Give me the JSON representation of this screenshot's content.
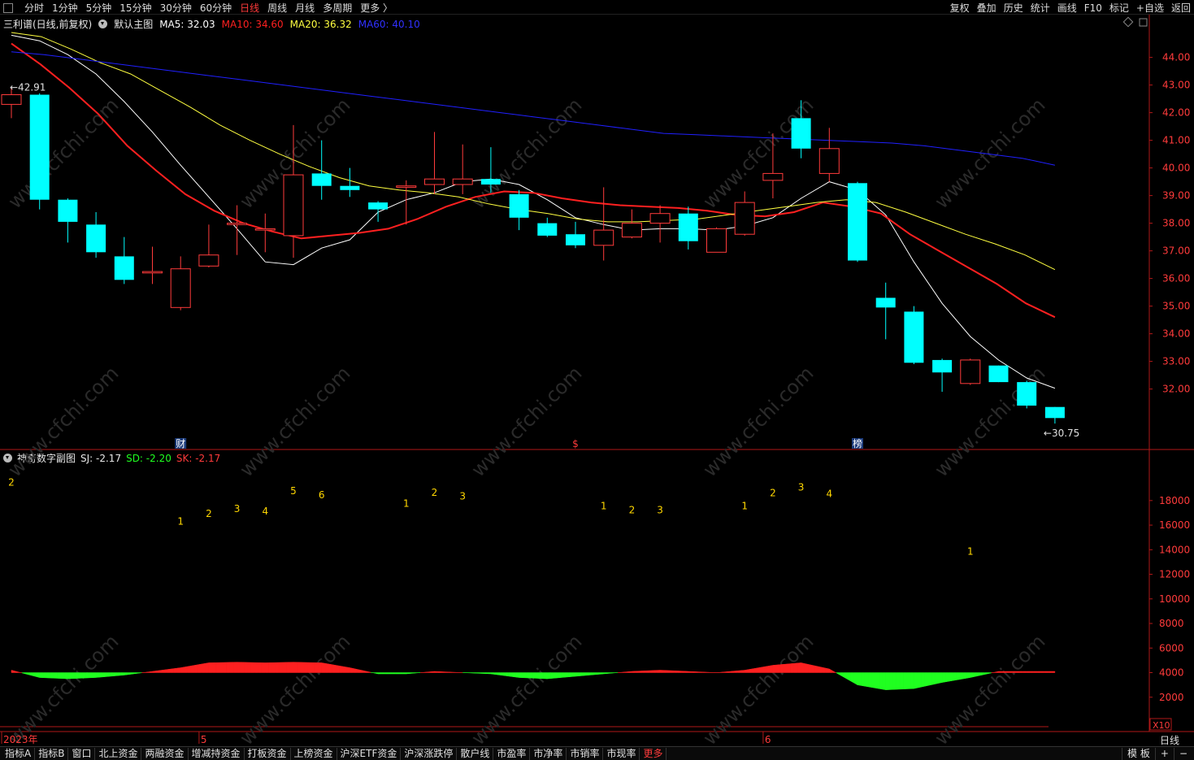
{
  "toolbar": {
    "periods": [
      "分时",
      "1分钟",
      "5分钟",
      "15分钟",
      "30分钟",
      "60分钟",
      "日线",
      "周线",
      "月线",
      "多周期",
      "更多 〉"
    ],
    "active_period": "日线",
    "right_items": [
      "复权",
      "叠加",
      "历史",
      "统计",
      "画线",
      "F10",
      "标记",
      "+自选",
      "返回"
    ]
  },
  "main_header": {
    "title": "三利谱(日线,前复权)",
    "indicator": "默认主图",
    "ma5": "MA5: 32.03",
    "ma10": "MA10: 34.60",
    "ma20": "MA20: 36.32",
    "ma60": "MA60: 40.10"
  },
  "sub_header": {
    "title": "神奇数字副图",
    "sj": "SJ: -2.17",
    "sd": "SD: -2.20",
    "sk": "SK: -2.17"
  },
  "colors": {
    "up": "#ff3b3b",
    "down": "#00ffff",
    "ma5": "#ffffff",
    "ma10": "#ff2020",
    "ma20": "#ffff40",
    "ma60": "#2020ff",
    "frame": "#b01818",
    "axis_text": "#ff3b3b",
    "count_text": "#ffd700"
  },
  "chart_data": [
    {
      "type": "candlestick",
      "title": "三利谱(日线,前复权)",
      "ylim": [
        30.4,
        44.9
      ],
      "y_ticks": [
        32.0,
        33.0,
        34.0,
        35.0,
        36.0,
        37.0,
        38.0,
        39.0,
        40.0,
        41.0,
        42.0,
        43.0,
        44.0
      ],
      "y_tick_labels": [
        "32.00",
        "33.00",
        "34.00",
        "35.00",
        "36.00",
        "37.00",
        "38.00",
        "39.00",
        "40.00",
        "41.00",
        "42.00",
        "43.00",
        "44.00"
      ],
      "high_label": "42.91",
      "low_label": "30.75",
      "candles": [
        {
          "o": 42.3,
          "c": 42.65,
          "h": 42.91,
          "l": 41.8
        },
        {
          "o": 42.65,
          "c": 38.85,
          "h": 42.7,
          "l": 38.5
        },
        {
          "o": 38.85,
          "c": 38.05,
          "h": 38.9,
          "l": 37.3
        },
        {
          "o": 37.95,
          "c": 36.95,
          "h": 38.4,
          "l": 36.75
        },
        {
          "o": 36.8,
          "c": 35.95,
          "h": 37.5,
          "l": 35.8
        },
        {
          "o": 36.2,
          "c": 36.25,
          "h": 37.15,
          "l": 35.8
        },
        {
          "o": 34.95,
          "c": 36.35,
          "h": 36.8,
          "l": 34.85
        },
        {
          "o": 36.45,
          "c": 36.85,
          "h": 37.95,
          "l": 36.4
        },
        {
          "o": 37.95,
          "c": 38.0,
          "h": 38.65,
          "l": 36.85
        },
        {
          "o": 37.75,
          "c": 37.8,
          "h": 38.35,
          "l": 36.95
        },
        {
          "o": 37.55,
          "c": 39.75,
          "h": 41.55,
          "l": 36.75
        },
        {
          "o": 39.8,
          "c": 39.35,
          "h": 41.0,
          "l": 38.85
        },
        {
          "o": 39.35,
          "c": 39.2,
          "h": 40.0,
          "l": 38.95
        },
        {
          "o": 38.75,
          "c": 38.5,
          "h": 38.8,
          "l": 38.05
        },
        {
          "o": 39.3,
          "c": 39.35,
          "h": 39.55,
          "l": 37.95
        },
        {
          "o": 39.4,
          "c": 39.6,
          "h": 41.3,
          "l": 39.05
        },
        {
          "o": 39.4,
          "c": 39.6,
          "h": 40.85,
          "l": 39.05
        },
        {
          "o": 39.6,
          "c": 39.4,
          "h": 40.75,
          "l": 39.1
        },
        {
          "o": 39.05,
          "c": 38.2,
          "h": 39.2,
          "l": 37.75
        },
        {
          "o": 38.0,
          "c": 37.55,
          "h": 38.2,
          "l": 37.5
        },
        {
          "o": 37.6,
          "c": 37.2,
          "h": 38.05,
          "l": 37.1
        },
        {
          "o": 37.2,
          "c": 37.75,
          "h": 39.3,
          "l": 36.65
        },
        {
          "o": 37.5,
          "c": 38.0,
          "h": 38.5,
          "l": 37.45
        },
        {
          "o": 38.0,
          "c": 38.35,
          "h": 38.65,
          "l": 37.3
        },
        {
          "o": 38.35,
          "c": 37.35,
          "h": 38.6,
          "l": 37.05
        },
        {
          "o": 36.95,
          "c": 37.8,
          "h": 37.85,
          "l": 36.95
        },
        {
          "o": 37.6,
          "c": 38.75,
          "h": 39.15,
          "l": 37.55
        },
        {
          "o": 39.55,
          "c": 39.8,
          "h": 41.25,
          "l": 38.9
        },
        {
          "o": 41.8,
          "c": 40.7,
          "h": 42.45,
          "l": 40.35
        },
        {
          "o": 39.8,
          "c": 40.7,
          "h": 41.45,
          "l": 39.5
        },
        {
          "o": 39.45,
          "c": 36.65,
          "h": 39.5,
          "l": 36.6
        },
        {
          "o": 35.3,
          "c": 34.95,
          "h": 35.85,
          "l": 33.8
        },
        {
          "o": 34.8,
          "c": 32.95,
          "h": 35.0,
          "l": 32.9
        },
        {
          "o": 33.05,
          "c": 32.6,
          "h": 33.1,
          "l": 31.9
        },
        {
          "o": 32.2,
          "c": 33.05,
          "h": 33.1,
          "l": 32.15
        },
        {
          "o": 32.85,
          "c": 32.25,
          "h": 32.85,
          "l": 32.25
        },
        {
          "o": 32.25,
          "c": 31.4,
          "h": 32.3,
          "l": 31.3
        },
        {
          "o": 31.35,
          "c": 30.95,
          "h": 31.35,
          "l": 30.75
        }
      ],
      "ma_series": [
        {
          "name": "MA5",
          "values": [
            44.8,
            44.6,
            44.1,
            43.4,
            42.4,
            41.3,
            40.1,
            38.95,
            37.8,
            36.6,
            36.5,
            37.1,
            37.4,
            38.4,
            38.85,
            39.1,
            39.5,
            39.6,
            39.4,
            38.85,
            38.2,
            37.95,
            37.75,
            37.8,
            37.8,
            37.75,
            37.9,
            38.2,
            38.9,
            39.5,
            39.2,
            38.3,
            36.6,
            35.1,
            33.9,
            33.05,
            32.4,
            32.03
          ]
        },
        {
          "name": "MA10",
          "values": [
            44.5,
            43.75,
            42.9,
            41.95,
            40.8,
            39.9,
            39.05,
            38.45,
            38.0,
            37.7,
            37.45,
            37.55,
            37.65,
            37.8,
            38.15,
            38.6,
            38.95,
            39.15,
            39.1,
            38.9,
            38.75,
            38.65,
            38.6,
            38.55,
            38.45,
            38.3,
            38.25,
            38.4,
            38.75,
            38.6,
            38.35,
            37.6,
            37.0,
            36.4,
            35.8,
            35.1,
            34.6
          ]
        },
        {
          "name": "MA20",
          "values": [
            44.9,
            44.75,
            44.3,
            43.8,
            43.4,
            42.8,
            42.2,
            41.55,
            41.0,
            40.5,
            40.05,
            39.65,
            39.35,
            39.2,
            39.1,
            38.95,
            38.7,
            38.5,
            38.35,
            38.15,
            38.05,
            38.05,
            38.1,
            38.15,
            38.3,
            38.45,
            38.6,
            38.75,
            38.85,
            38.75,
            38.4,
            38.0,
            37.6,
            37.25,
            36.85,
            36.32
          ]
        },
        {
          "name": "MA60",
          "values": [
            44.2,
            44.1,
            43.95,
            43.8,
            43.65,
            43.5,
            43.35,
            43.2,
            43.05,
            42.9,
            42.75,
            42.6,
            42.45,
            42.3,
            42.15,
            42.0,
            41.85,
            41.7,
            41.55,
            41.4,
            41.25,
            41.2,
            41.15,
            41.1,
            41.05,
            41.0,
            40.95,
            40.9,
            40.8,
            40.65,
            40.5,
            40.35,
            40.1
          ]
        }
      ],
      "markers": [
        {
          "index": 6,
          "label": "财"
        },
        {
          "index": 20,
          "label": "$"
        },
        {
          "index": 30,
          "label": "榜"
        }
      ]
    },
    {
      "type": "area",
      "title": "神奇数字副图",
      "ylim": [
        0,
        20500
      ],
      "y_ticks": [
        2000,
        4000,
        6000,
        8000,
        10000,
        12000,
        14000,
        16000,
        18000
      ],
      "y_tick_labels": [
        "2000",
        "4000",
        "6000",
        "8000",
        "10000",
        "12000",
        "14000",
        "16000",
        "18000"
      ],
      "baseline": 4000,
      "area_values": [
        4200,
        3600,
        3500,
        3600,
        3800,
        4100,
        4400,
        4800,
        4850,
        4800,
        4850,
        4800,
        4400,
        3900,
        3900,
        4100,
        4000,
        3900,
        3600,
        3500,
        3700,
        3900,
        4100,
        4200,
        4100,
        4000,
        4200,
        4600,
        4800,
        4300,
        3000,
        2600,
        2700,
        3200,
        3600,
        4100,
        4100,
        4100
      ],
      "counts": [
        {
          "index": 0,
          "value": "2",
          "y": 19200
        },
        {
          "index": 6,
          "value": "1",
          "y": 16050
        },
        {
          "index": 7,
          "value": "2",
          "y": 16650
        },
        {
          "index": 8,
          "value": "3",
          "y": 17050
        },
        {
          "index": 9,
          "value": "4",
          "y": 16850
        },
        {
          "index": 10,
          "value": "5",
          "y": 18500
        },
        {
          "index": 11,
          "value": "6",
          "y": 18200
        },
        {
          "index": 14,
          "value": "1",
          "y": 17500
        },
        {
          "index": 15,
          "value": "2",
          "y": 18400
        },
        {
          "index": 16,
          "value": "3",
          "y": 18100
        },
        {
          "index": 21,
          "value": "1",
          "y": 17300
        },
        {
          "index": 22,
          "value": "2",
          "y": 16950
        },
        {
          "index": 23,
          "value": "3",
          "y": 16950
        },
        {
          "index": 26,
          "value": "1",
          "y": 17300
        },
        {
          "index": 27,
          "value": "2",
          "y": 18350
        },
        {
          "index": 28,
          "value": "3",
          "y": 18800
        },
        {
          "index": 29,
          "value": "4",
          "y": 18300
        },
        {
          "index": 34,
          "value": "1",
          "y": 13600
        }
      ],
      "x_labels": [
        {
          "index": 0,
          "label": "2023年"
        },
        {
          "index": 7,
          "label": "5"
        },
        {
          "index": 27,
          "label": "6"
        }
      ],
      "scale_label": "X10"
    }
  ],
  "watermark": "www.cfchi.com",
  "bottom_tabs": [
    "指标A",
    "指标B",
    "窗口",
    "北上资金",
    "两融资金",
    "增减持资金",
    "打板资金",
    "上榜资金",
    "沪深ETF资金",
    "沪深涨跌停",
    "散户线",
    "市盈率",
    "市净率",
    "市销率",
    "市现率",
    "更多"
  ],
  "bottom_right": [
    "模 板",
    "+",
    "−"
  ],
  "period_label": "日线"
}
